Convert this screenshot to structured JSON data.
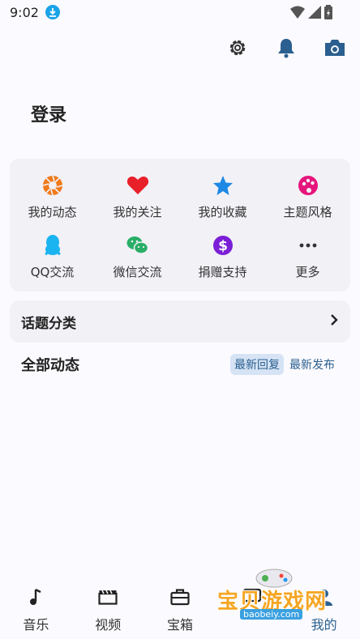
{
  "status_bar": {
    "time": "9:02"
  },
  "header": {
    "title": "登录"
  },
  "top_actions": [
    {
      "name": "settings-button",
      "icon": "gear-icon"
    },
    {
      "name": "notifications-button",
      "icon": "bell-icon"
    },
    {
      "name": "camera-button",
      "icon": "camera-icon"
    }
  ],
  "grid": {
    "items": [
      {
        "label": "我的动态",
        "icon": "aperture-icon",
        "color": "#f07a1a"
      },
      {
        "label": "我的关注",
        "icon": "heart-icon",
        "color": "#e8202a"
      },
      {
        "label": "我的收藏",
        "icon": "star-icon",
        "color": "#1e88e5"
      },
      {
        "label": "主题风格",
        "icon": "palette-icon",
        "color": "#e6157c"
      },
      {
        "label": "QQ交流",
        "icon": "qq-icon",
        "color": "#1ab4f0"
      },
      {
        "label": "微信交流",
        "icon": "wechat-icon",
        "color": "#2aae67"
      },
      {
        "label": "捐赠支持",
        "icon": "dollar-icon",
        "color": "#7b1fd6"
      },
      {
        "label": "更多",
        "icon": "more-dots-icon",
        "color": "#333333"
      }
    ]
  },
  "topic": {
    "label": "话题分类"
  },
  "feed": {
    "title": "全部动态",
    "sort_reply": "最新回复",
    "sort_publish": "最新发布"
  },
  "bottom_nav": {
    "items": [
      {
        "label": "音乐",
        "icon": "music-note-icon"
      },
      {
        "label": "视频",
        "icon": "clapper-icon"
      },
      {
        "label": "宝箱",
        "icon": "briefcase-icon"
      },
      {
        "label": "",
        "icon": "chat-icon"
      },
      {
        "label": "我的",
        "icon": "profile-icon"
      }
    ]
  },
  "watermark": {
    "text": "宝贝游戏网",
    "url": "baobeiy.com"
  },
  "colors": {
    "accent": "#2a5f8f",
    "background": "#fbfafe",
    "card": "#f2f1f6"
  }
}
